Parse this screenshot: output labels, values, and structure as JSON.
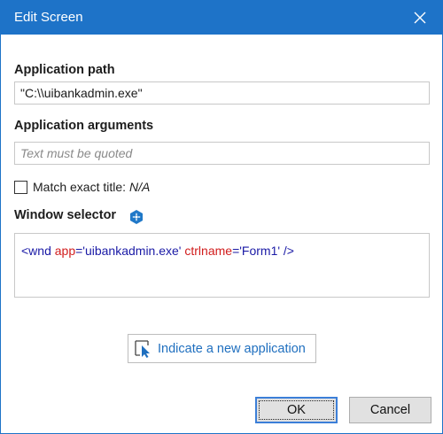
{
  "window": {
    "title": "Edit Screen",
    "close_icon": "close-icon"
  },
  "application_path": {
    "label": "Application path",
    "value": "\"C:\\\\uibankadmin.exe\""
  },
  "application_arguments": {
    "label": "Application arguments",
    "placeholder": "Text must be quoted",
    "value": ""
  },
  "match_exact_title": {
    "label": "Match exact title:",
    "value": "N/A",
    "checked": false
  },
  "window_selector": {
    "label": "Window selector",
    "icon": "selector-editor-icon",
    "selector": {
      "open": "<wnd ",
      "attr1_name": "app",
      "attr1_value": "='uibankadmin.exe' ",
      "attr2_name": "ctrlname",
      "attr2_value": "='Form1' ",
      "close": "/>"
    }
  },
  "indicate": {
    "label": "Indicate a new application",
    "icon": "pointer-select-icon"
  },
  "buttons": {
    "ok": "OK",
    "cancel": "Cancel"
  },
  "colors": {
    "titlebar": "#1e73c8",
    "link_blue": "#1f6fbf",
    "selector_tag": "#1a1aa6",
    "selector_attr": "#d11c1c"
  }
}
